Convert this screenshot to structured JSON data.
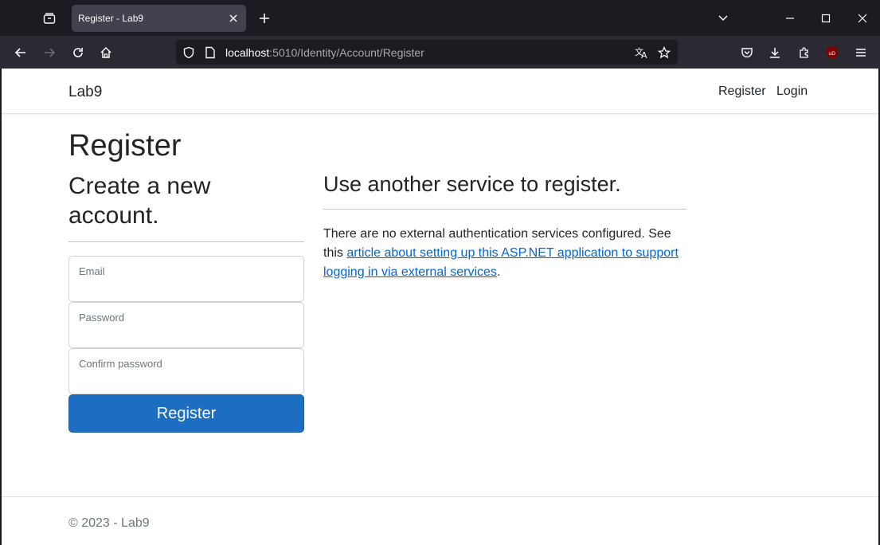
{
  "browser": {
    "tab_title": "Register - Lab9",
    "url_host": "localhost",
    "url_rest": ":5010/Identity/Account/Register",
    "icons": {
      "tab_list": "tab-list-icon",
      "close_tab": "close-icon",
      "new_tab": "plus-icon",
      "back": "arrow-left-icon",
      "forward": "arrow-right-icon",
      "reload": "reload-icon",
      "home": "home-icon",
      "shield": "shield-icon",
      "page": "page-icon",
      "translate": "translate-icon",
      "bookmark": "star-icon",
      "pocket": "pocket-icon",
      "downloads": "download-icon",
      "extensions": "puzzle-icon",
      "ublock": "ublock-icon",
      "menu": "hamburger-icon"
    }
  },
  "site": {
    "brand": "Lab9",
    "nav": {
      "register": "Register",
      "login": "Login"
    }
  },
  "page": {
    "title": "Register",
    "subtitle": "Create a new account.",
    "form": {
      "email_label": "Email",
      "password_label": "Password",
      "confirm_password_label": "Confirm password",
      "submit_label": "Register"
    },
    "external": {
      "heading": "Use another service to register.",
      "text_before": "There are no external authentication services configured. See this ",
      "link_text": "article about setting up this ASP.NET application to support logging in via external services",
      "text_after": "."
    }
  },
  "footer": {
    "text": "© 2023 - Lab9"
  },
  "colors": {
    "primary_button": "#1b6ec2",
    "link": "#0366d6",
    "chrome_bg": "#1c1b22"
  }
}
